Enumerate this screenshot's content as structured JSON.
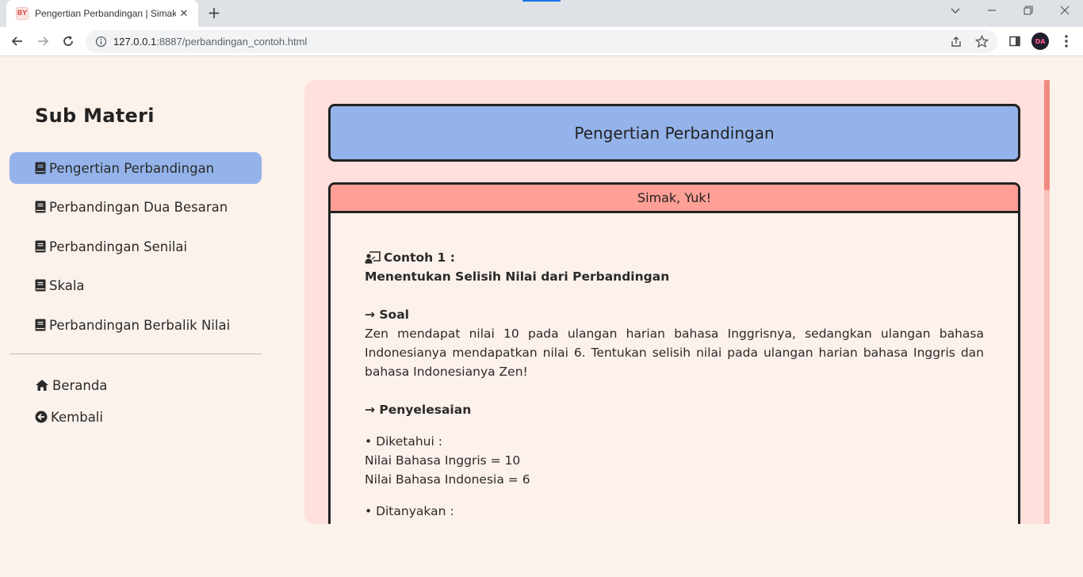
{
  "browser": {
    "tab_title": "Pengertian Perbandingan | Simak, Yuk!",
    "tab_favicon": "BY",
    "new_tab_label": "+",
    "url_host": "127.0.0.1",
    "url_path": ":8887/perbandingan_contoh.html",
    "profile_initials": "DA"
  },
  "sidebar": {
    "title": "Sub Materi",
    "items": [
      {
        "label": "Pengertian Perbandingan",
        "icon": "book-icon",
        "active": true
      },
      {
        "label": "Perbandingan Dua Besaran",
        "icon": "book-icon",
        "active": false
      },
      {
        "label": "Perbandingan Senilai",
        "icon": "book-icon",
        "active": false
      },
      {
        "label": "Skala",
        "icon": "book-icon",
        "active": false
      },
      {
        "label": "Perbandingan Berbalik Nilai",
        "icon": "book-icon",
        "active": false
      }
    ],
    "links": [
      {
        "label": "Beranda",
        "icon": "home-icon"
      },
      {
        "label": "Kembali",
        "icon": "arrow-circle-left-icon"
      }
    ]
  },
  "main": {
    "title": "Pengertian Perbandingan",
    "card_header": "Simak, Yuk!",
    "example": {
      "label": "Contoh 1 :",
      "heading": "Menentukan Selisih Nilai dari Perbandingan",
      "soal_label": "→ Soal",
      "soal_text": "Zen mendapat nilai 10 pada ulangan harian bahasa Inggrisnya, sedangkan ulangan bahasa Indonesianya mendapatkan nilai 6. Tentukan selisih nilai pada ulangan harian bahasa Inggris dan bahasa Indonesianya Zen!",
      "penyelesaian_label": "→ Penyelesaian",
      "diketahui_label": "•  Diketahui :",
      "diketahui_items": [
        "Nilai Bahasa Inggris = 10",
        "Nilai Bahasa Indonesia = 6"
      ],
      "ditanyakan_label": "•  Ditanyakan :"
    }
  },
  "colors": {
    "page_bg": "#fcf2ec",
    "active_item": "#94b3ea",
    "panel_bg": "#ffe0dd",
    "card_header": "#ff9f96",
    "scroll_thumb": "#f08a80"
  }
}
